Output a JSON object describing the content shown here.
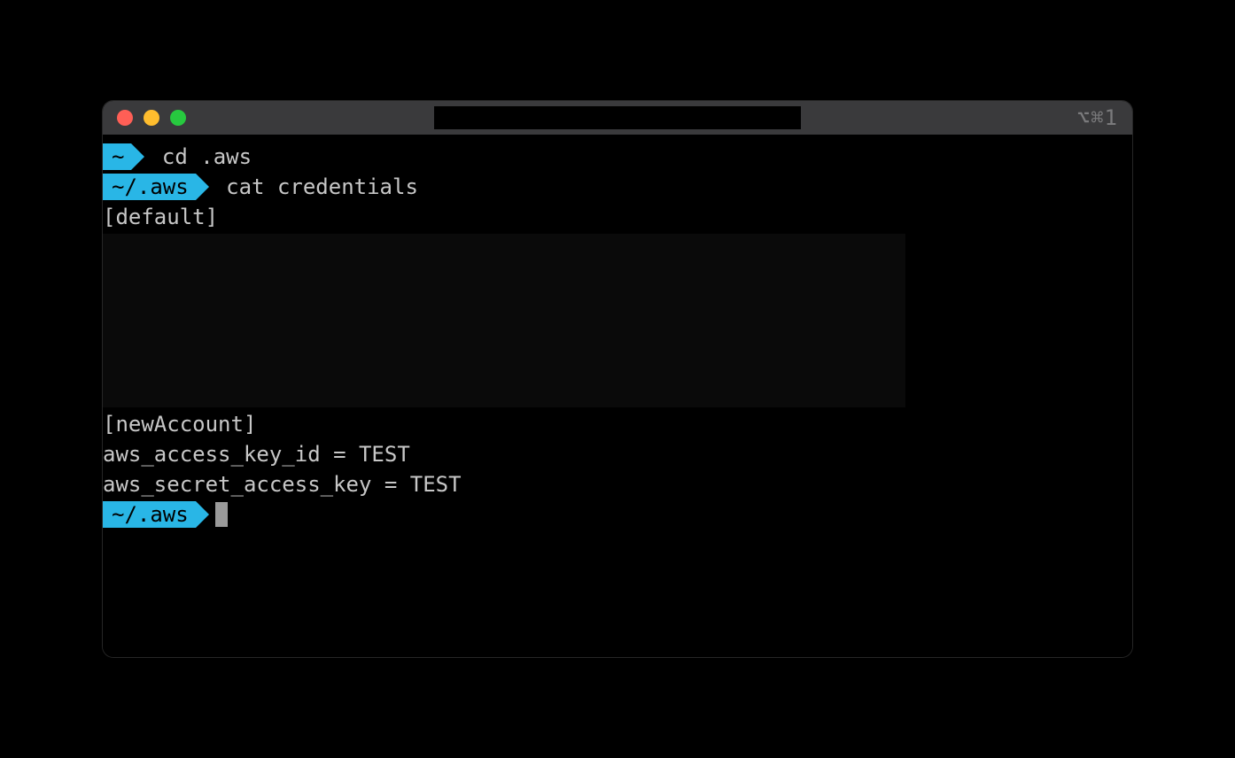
{
  "titlebar": {
    "shortcut": "⌥⌘1"
  },
  "lines": {
    "prompt1": "~",
    "cmd1": " cd .aws",
    "prompt2": "~/.aws",
    "cmd2": " cat credentials",
    "out_default": "[default]",
    "out_newaccount": "[newAccount]",
    "out_access": "aws_access_key_id = TEST",
    "out_secret": "aws_secret_access_key = TEST",
    "prompt3": "~/.aws"
  }
}
